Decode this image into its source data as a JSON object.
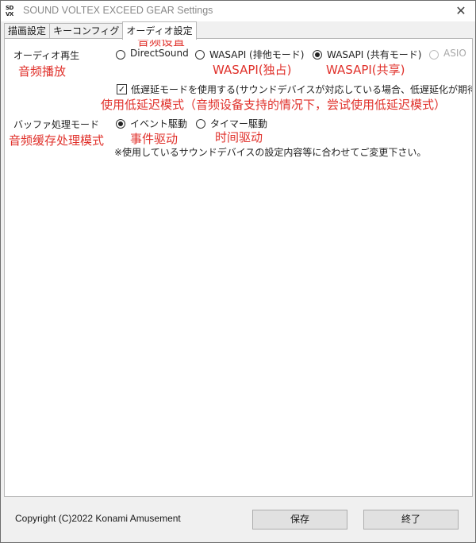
{
  "window": {
    "title": "SOUND VOLTEX EXCEED GEAR Settings",
    "icon_text": "SDVX",
    "close_glyph": "✕"
  },
  "tabs": [
    {
      "label": "描画設定"
    },
    {
      "label": "キーコンフィグ"
    },
    {
      "label": "オーディオ設定",
      "active": true
    }
  ],
  "annotations": {
    "tab_audio": "音频设置",
    "audio_playback": "音频播放",
    "wasapi_exclusive": "WASAPI(独占)",
    "wasapi_shared": "WASAPI(共享)",
    "low_latency": "使用低延迟模式（音频设备支持的情况下，尝试使用低延迟模式）",
    "buffer_mode": "音频缓存处理模式",
    "event_driven": "事件驱动",
    "timer_driven": "时间驱动"
  },
  "audio": {
    "playback_label": "オーディオ再生",
    "options": [
      {
        "label": "DirectSound",
        "checked": false,
        "disabled": false
      },
      {
        "label": "WASAPI (排他モード)",
        "checked": false,
        "disabled": false
      },
      {
        "label": "WASAPI (共有モード)",
        "checked": true,
        "disabled": false
      },
      {
        "label": "ASIO",
        "checked": false,
        "disabled": true
      }
    ],
    "low_latency_label": "低遅延モードを使用する(サウンドデバイスが対応している場合、低遅延化が期待",
    "low_latency_checked": true,
    "check_glyph": "✓",
    "buffer_label": "バッファ処理モード",
    "buffer_options": [
      {
        "label": "イベント駆動",
        "checked": true
      },
      {
        "label": "タイマー駆動",
        "checked": false
      }
    ],
    "note": "※使用しているサウンドデバイスの設定内容等に合わせてご変更下さい。"
  },
  "footer": {
    "copyright": "Copyright (C)2022 Konami Amusement",
    "save_label": "保存",
    "exit_label": "終了"
  },
  "colors": {
    "annotation": "#e0312b",
    "button_bg": "#e1e1e1"
  }
}
